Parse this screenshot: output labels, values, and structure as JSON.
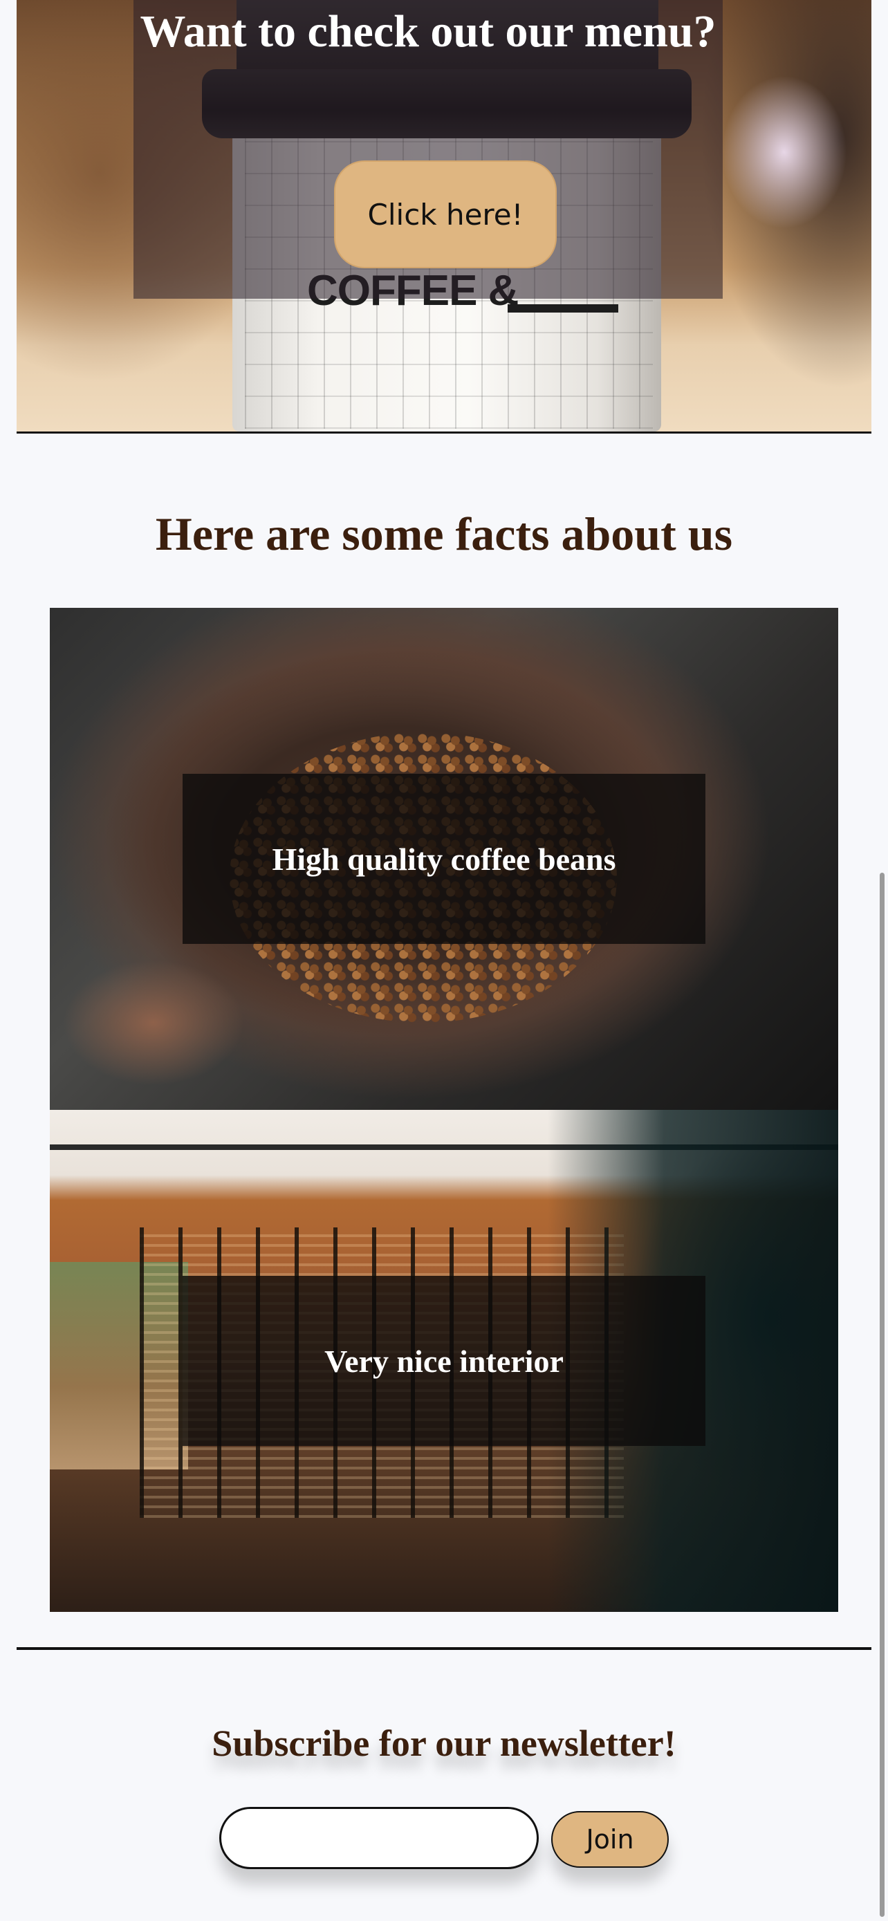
{
  "hero": {
    "title": "Want to check out our menu?",
    "button_label": "Click here!",
    "cup_text": "COFFEE &"
  },
  "facts": {
    "title": "Here are some facts about us",
    "items": [
      {
        "text": "High quality coffee beans"
      },
      {
        "text": "Very nice interior"
      }
    ]
  },
  "newsletter": {
    "title": "Subscribe for our newsletter!",
    "input_value": "",
    "button_label": "Join"
  },
  "colors": {
    "accent": "#dfb681",
    "heading": "#3b1f0e",
    "background": "#f7f8fb"
  }
}
